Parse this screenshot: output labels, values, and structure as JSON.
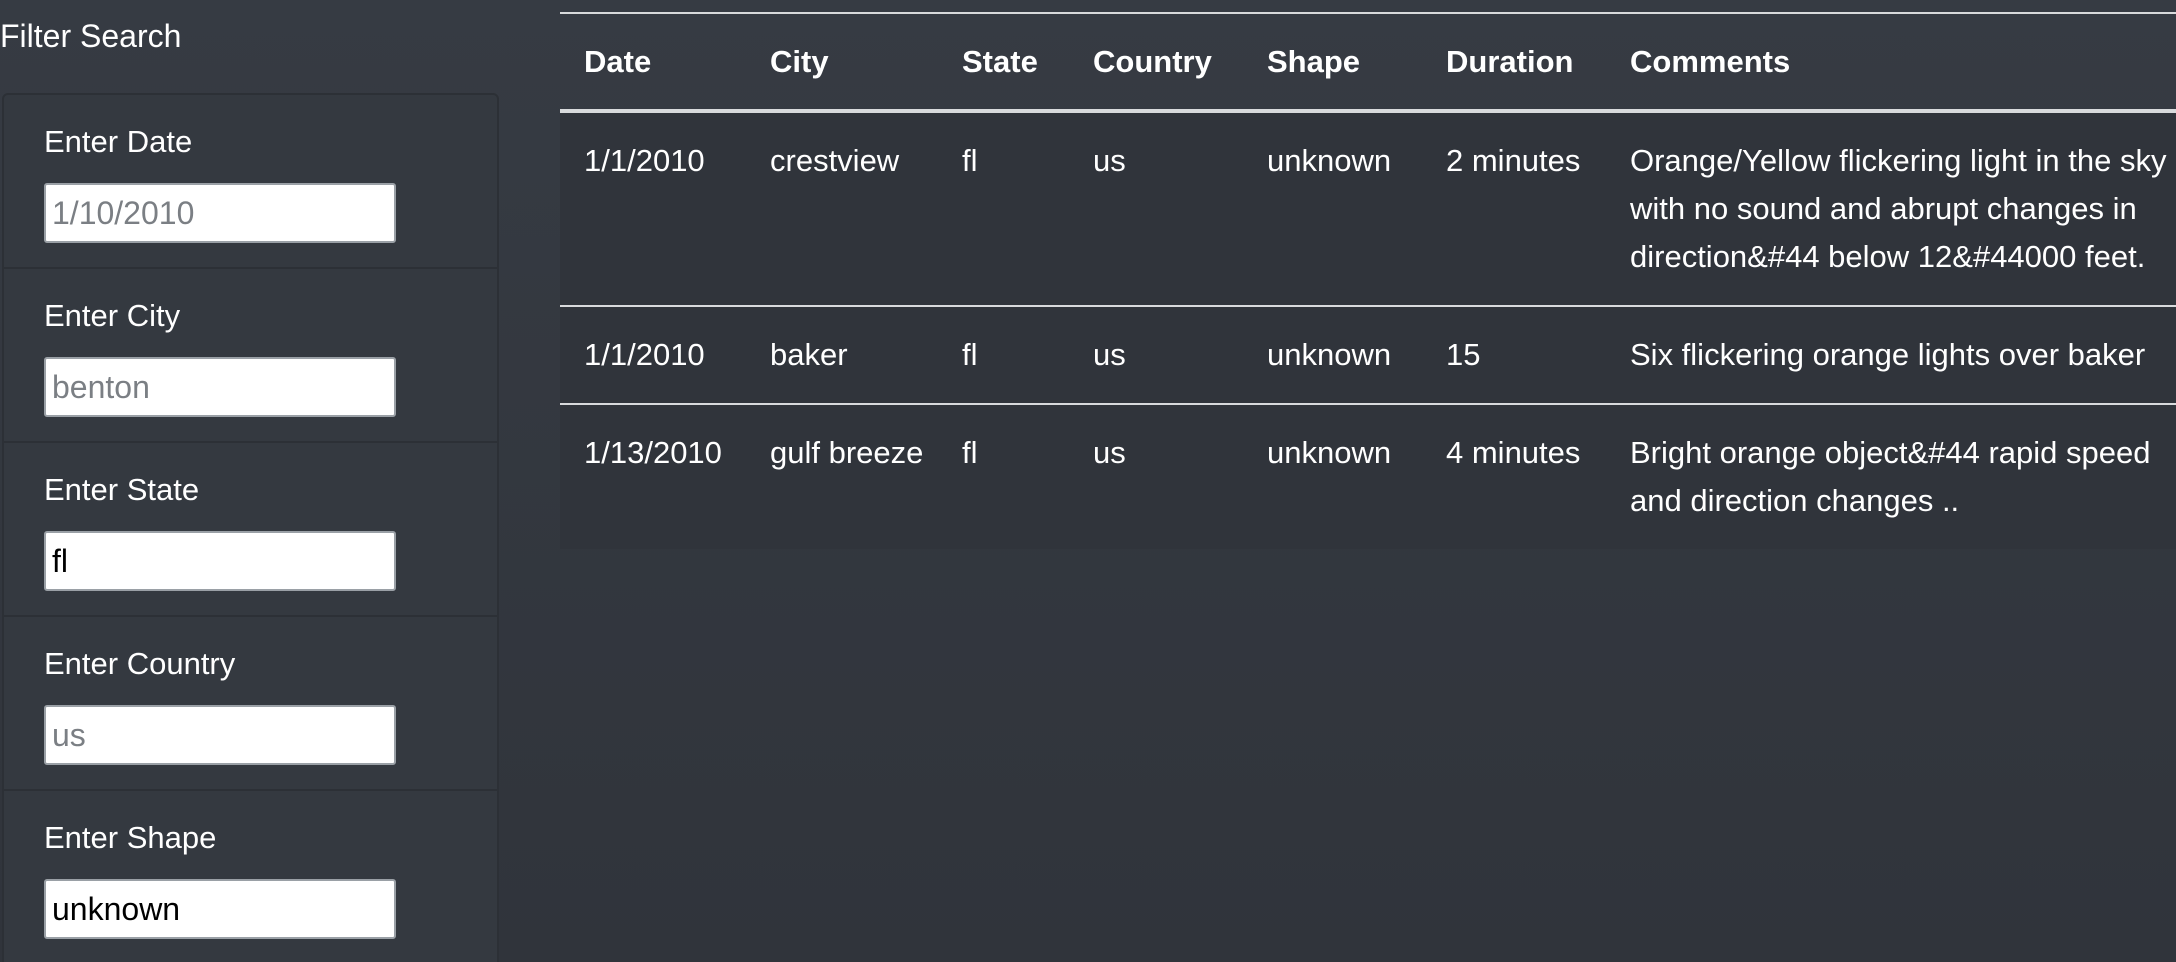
{
  "sidebar": {
    "title": "Filter Search",
    "filters": [
      {
        "label": "Enter Date",
        "value": "",
        "placeholder": "1/10/2010"
      },
      {
        "label": "Enter City",
        "value": "",
        "placeholder": "benton"
      },
      {
        "label": "Enter State",
        "value": "fl",
        "placeholder": ""
      },
      {
        "label": "Enter Country",
        "value": "",
        "placeholder": "us"
      },
      {
        "label": "Enter Shape",
        "value": "unknown",
        "placeholder": ""
      }
    ]
  },
  "table": {
    "headers": [
      "Date",
      "City",
      "State",
      "Country",
      "Shape",
      "Duration",
      "Comments"
    ],
    "rows": [
      {
        "date": "1/1/2010",
        "city": "crestview",
        "state": "fl",
        "country": "us",
        "shape": "unknown",
        "duration": "2 minutes",
        "comments": "Orange/Yellow flickering light in the sky with no sound and abrupt changes in direction&#44 below 12&#44000 feet."
      },
      {
        "date": "1/1/2010",
        "city": "baker",
        "state": "fl",
        "country": "us",
        "shape": "unknown",
        "duration": "15",
        "comments": "Six flickering orange lights over baker"
      },
      {
        "date": "1/13/2010",
        "city": "gulf breeze",
        "state": "fl",
        "country": "us",
        "shape": "unknown",
        "duration": "4 minutes",
        "comments": "Bright orange object&#44 rapid speed and direction changes .."
      }
    ]
  },
  "colors": {
    "background": "#363b43",
    "panel": "#343940",
    "row": "#30343b",
    "rule": "#d8dadc"
  }
}
